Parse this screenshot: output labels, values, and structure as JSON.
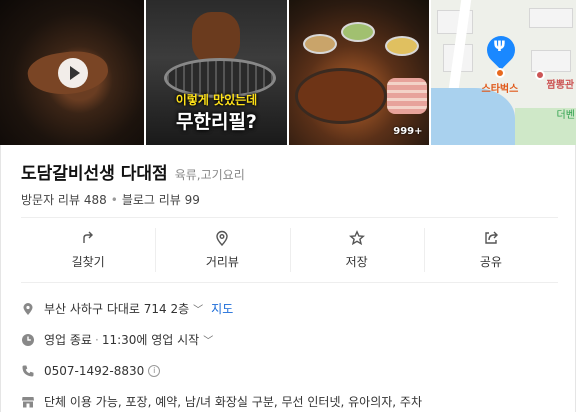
{
  "photos": {
    "overlay_line1": "이렇게 맛있는데",
    "overlay_line2": "무한리필?",
    "count": "999+"
  },
  "map": {
    "labels": [
      "스타벅스",
      "짬뽕관",
      "더벤"
    ]
  },
  "place": {
    "name": "도담갈비선생 다대점",
    "category": "육류,고기요리",
    "visitor_reviews": "방문자 리뷰 488",
    "blog_reviews": "블로그 리뷰 99"
  },
  "actions": [
    {
      "label": "길찾기",
      "icon": "directions-icon"
    },
    {
      "label": "거리뷰",
      "icon": "street-view-icon"
    },
    {
      "label": "저장",
      "icon": "star-icon"
    },
    {
      "label": "공유",
      "icon": "share-icon"
    }
  ],
  "details": {
    "address": "부산 사하구 다대로 714 2층",
    "map_link": "지도",
    "status": "영업 종료",
    "status_detail": "11:30에 영업 시작",
    "phone": "0507-1492-8830",
    "amenities": "단체 이용 가능, 포장, 예약, 남/녀 화장실 구분, 무선 인터넷, 유아의자, 주차"
  },
  "colors": {
    "link": "#1a6bd8",
    "map_pin": "#1a88ff"
  }
}
